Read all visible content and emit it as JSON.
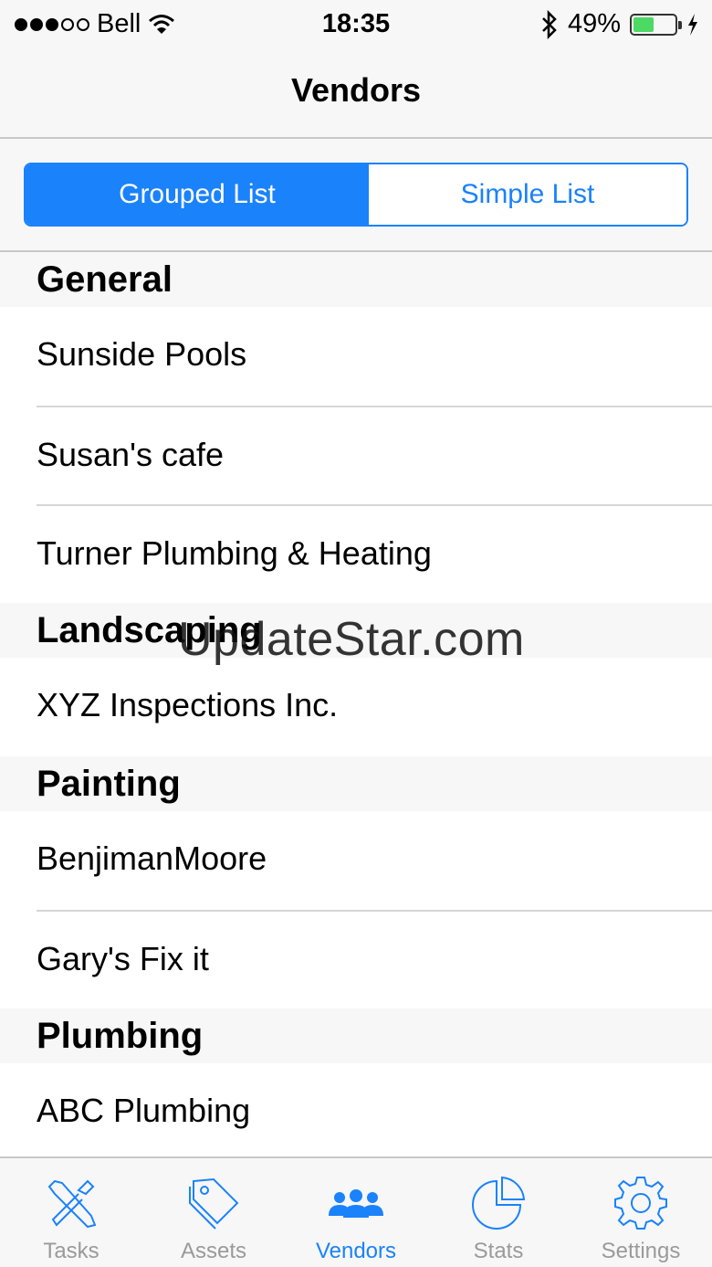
{
  "status_bar": {
    "carrier": "Bell",
    "time": "18:35",
    "battery": "49%",
    "battery_level": 0.49,
    "signal_bars_filled": 3,
    "signal_bars_total": 5
  },
  "nav": {
    "title": "Vendors"
  },
  "segment": {
    "options": [
      "Grouped List",
      "Simple List"
    ],
    "selected": "Grouped List"
  },
  "sections": [
    {
      "title": "General",
      "items": [
        "Sunside Pools",
        "Susan's cafe",
        "Turner Plumbing & Heating"
      ]
    },
    {
      "title": "Landscaping",
      "items": [
        "XYZ Inspections Inc."
      ]
    },
    {
      "title": "Painting",
      "items": [
        "BenjimanMoore",
        "Gary's Fix it"
      ]
    },
    {
      "title": "Plumbing",
      "items": [
        "ABC Plumbing"
      ]
    }
  ],
  "watermark": "UpdateStar.com",
  "tabbar": {
    "tabs": [
      {
        "label": "Tasks",
        "icon": "tools-icon"
      },
      {
        "label": "Assets",
        "icon": "tags-icon"
      },
      {
        "label": "Vendors",
        "icon": "people-icon"
      },
      {
        "label": "Stats",
        "icon": "pie-chart-icon"
      },
      {
        "label": "Settings",
        "icon": "gear-icon"
      }
    ],
    "active": "Vendors"
  },
  "colors": {
    "accent": "#1a82fb",
    "battery": "#4cd964",
    "inactive": "#9a9a9a"
  }
}
